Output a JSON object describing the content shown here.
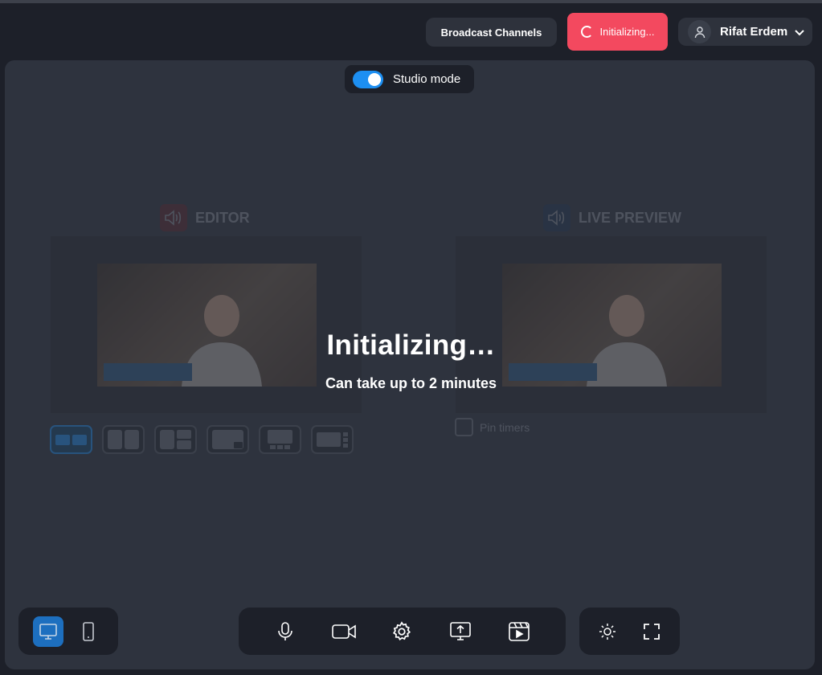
{
  "header": {
    "broadcast_channels": "Broadcast Channels",
    "status_button": "Initializing...",
    "user_name": "Rifat Erdem"
  },
  "studio_mode": {
    "label": "Studio mode",
    "enabled": true
  },
  "editor": {
    "title": "EDITOR"
  },
  "live_preview": {
    "title": "LIVE PREVIEW"
  },
  "pin_timers": {
    "label": "Pin timers",
    "checked": false
  },
  "overlay": {
    "title": "Initializing…",
    "subtitle": "Can take up to 2 minutes"
  },
  "layouts": [
    "side-by-side",
    "two-split",
    "grid-three",
    "picture-in-picture",
    "single-with-thumbs",
    "single-with-sidebar"
  ],
  "selected_layout": "side-by-side",
  "device_view": {
    "selected": "desktop",
    "options": [
      "desktop",
      "mobile"
    ]
  },
  "controls": [
    "microphone-icon",
    "camera-icon",
    "settings-gear-icon",
    "share-screen-icon",
    "media-clip-icon"
  ],
  "view_controls": [
    "brightness-icon",
    "fullscreen-icon"
  ],
  "colors": {
    "accent": "#1d8ff2",
    "live_button": "#f3495f",
    "panel": "#2e333e",
    "background": "#1d2029"
  }
}
